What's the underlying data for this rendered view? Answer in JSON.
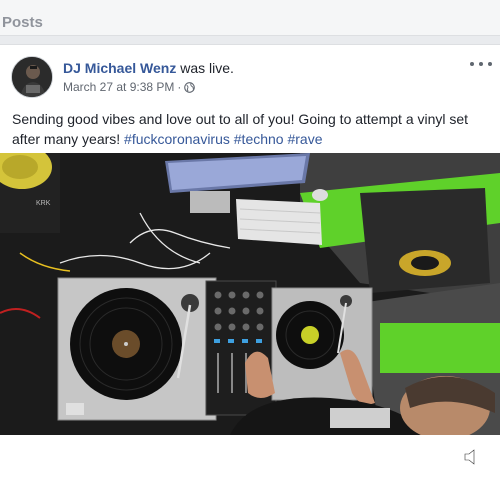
{
  "section": {
    "title": "Posts"
  },
  "post": {
    "author": "DJ Michael Wenz",
    "action": "was live.",
    "timestamp": "March 27 at 9:38 PM",
    "separator": "·",
    "text_line1": "Sending good vibes and love out to all of you! Going to attempt a vinyl set",
    "text_line2_plain": "after many years! ",
    "hashtags": [
      "#fuckcoronavirus",
      "#techno",
      "#rave"
    ],
    "video_label": "KRK",
    "record_label_left": "",
    "colors": {
      "link": "#365899",
      "meta": "#616770",
      "accent_green": "#5fd12a"
    }
  },
  "icons": {
    "privacy": "globe-icon",
    "menu": "more-dots-icon",
    "audio": "volume-icon"
  }
}
